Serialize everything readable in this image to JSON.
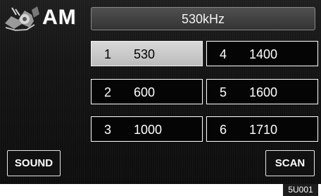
{
  "header": {
    "band": "AM",
    "frequency": "530kHz"
  },
  "presets": [
    {
      "number": "1",
      "frequency": "530",
      "selected": true
    },
    {
      "number": "2",
      "frequency": "600",
      "selected": false
    },
    {
      "number": "3",
      "frequency": "1000",
      "selected": false
    },
    {
      "number": "4",
      "frequency": "1400",
      "selected": false
    },
    {
      "number": "5",
      "frequency": "1600",
      "selected": false
    },
    {
      "number": "6",
      "frequency": "1710",
      "selected": false
    }
  ],
  "buttons": {
    "sound": "SOUND",
    "scan": "SCAN"
  },
  "figure_code": "5U001",
  "icons": {
    "band_logo": "radio-logo-icon"
  },
  "colors": {
    "screen": "#111111",
    "selected_preset": "#c8c8c8"
  }
}
